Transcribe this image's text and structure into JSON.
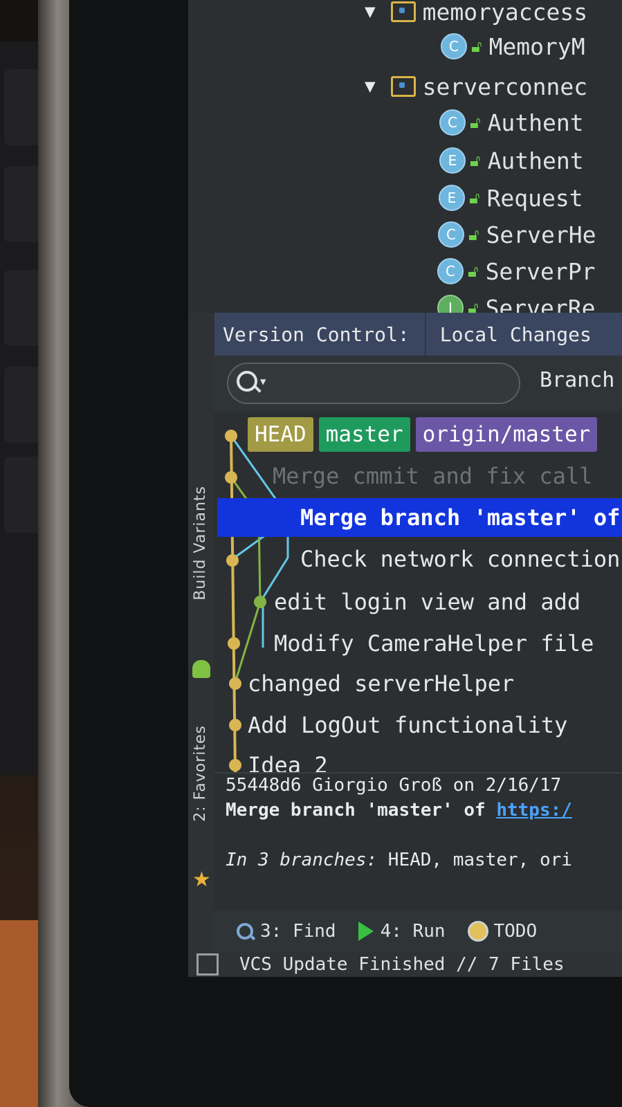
{
  "project_tree": {
    "rows": [
      {
        "kind": "folder",
        "label": "memoryaccess"
      },
      {
        "kind": "class",
        "badge": "C",
        "label": "MemoryM"
      },
      {
        "kind": "folder",
        "label": "serverconnec"
      },
      {
        "kind": "class",
        "badge": "C",
        "label": "Authent"
      },
      {
        "kind": "class",
        "badge": "E",
        "label": "Authent"
      },
      {
        "kind": "class",
        "badge": "E",
        "label": "Request"
      },
      {
        "kind": "class",
        "badge": "C",
        "label": "ServerHe"
      },
      {
        "kind": "class",
        "badge": "C",
        "label": "ServerPr"
      },
      {
        "kind": "class",
        "badge": "I",
        "label": "ServerRe"
      }
    ]
  },
  "side_tabs": {
    "build_variants": "Build Variants",
    "favorites": "2: Favorites"
  },
  "version_control": {
    "label": "Version Control:",
    "tab": "Local Changes"
  },
  "log_toolbar": {
    "search_placeholder": "",
    "branch_filter": "Branch"
  },
  "log": {
    "refs": [
      "HEAD",
      "master",
      "origin/master"
    ],
    "commits": [
      {
        "message": "Merge cmmit and fix call"
      },
      {
        "message": "Merge branch 'master' of"
      },
      {
        "message": "Check network connection"
      },
      {
        "message": "edit login view and add"
      },
      {
        "message": "Modify CameraHelper file"
      },
      {
        "message": "changed serverHelper"
      },
      {
        "message": "Add LogOut functionality"
      },
      {
        "message": "Idea 2"
      }
    ],
    "colors": {
      "yellow": "#d8b654",
      "cyan": "#64c7e8",
      "green": "#84b446",
      "selection": "#1234dc"
    }
  },
  "details": {
    "hash_line": "55448d6 Giorgio Groß on 2/16/17",
    "message_prefix": "Merge branch 'master' of ",
    "message_link": "https:/",
    "branches_label": "In 3 branches:",
    "branches_value": " HEAD, master, ori"
  },
  "bottom_tools": {
    "find": "3: Find",
    "run": "4: Run",
    "todo": "TODO"
  },
  "status": {
    "text": "VCS Update Finished // 7 Files"
  }
}
